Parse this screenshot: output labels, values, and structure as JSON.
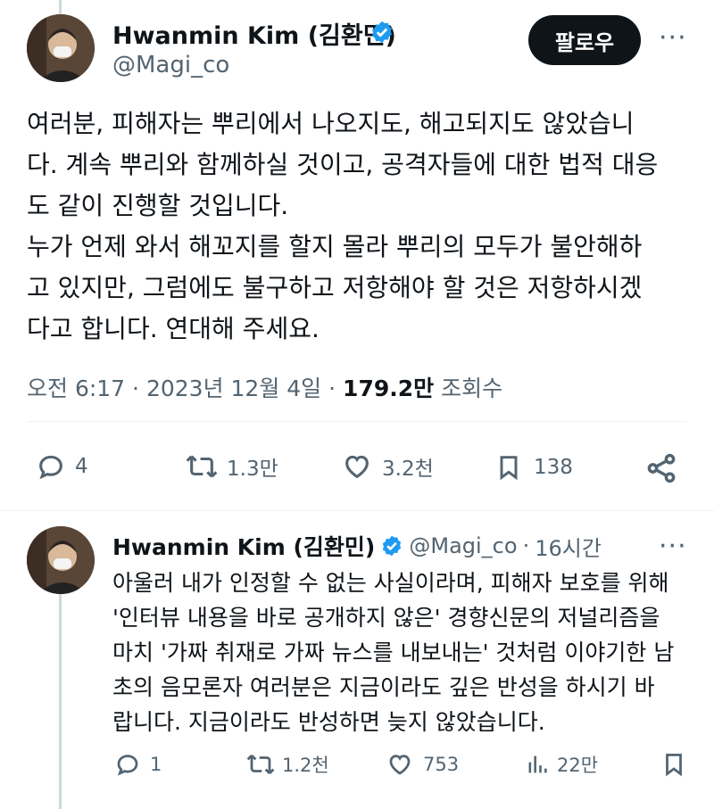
{
  "main_tweet": {
    "author_name": "Hwanmin Kim (김환민)",
    "handle": "@Magi_co",
    "follow_label": "팔로우",
    "more_label": "···",
    "lines": [
      "여러분, 피해자는 뿌리에서 나오지도, 해고되지도 않았습니",
      "다. 계속 뿌리와 함께하실 것이고, 공격자들에 대한 법적 대응",
      "도 같이 진행할 것입니다.",
      "누가 언제 와서 해꼬지를 할지 몰라 뿌리의 모두가 불안해하",
      "고 있지만, 그럼에도 불구하고 저항해야 할 것은 저항하시겠",
      "다고 합니다. 연대해 주세요."
    ],
    "time": "오전 6:17",
    "date": "2023년 12월 4일",
    "views_count": "179.2만",
    "views_label": "조회수",
    "actions": {
      "replies": "4",
      "retweets": "1.3만",
      "likes": "3.2천",
      "bookmarks": "138"
    }
  },
  "reply_tweet": {
    "author_name": "Hwanmin Kim (김환민)",
    "handle": "@Magi_co",
    "time_ago": "16시간",
    "more_label": "···",
    "lines": [
      "아울러 내가 인정할 수 없는 사실이라며, 피해자 보호를 위해",
      "'인터뷰 내용을 바로 공개하지 않은' 경향신문의 저널리즘을",
      "마치 '가짜 취재로 가짜 뉴스를 내보내는' 것처럼 이야기한 남",
      "초의 음모론자 여러분은 지금이라도 깊은 반성을 하시기 바",
      "랍니다. 지금이라도 반성하면 늦지 않았습니다."
    ],
    "actions": {
      "replies": "1",
      "retweets": "1.2천",
      "likes": "753",
      "views": "22만"
    }
  },
  "colors": {
    "verified": "#1d9bf0",
    "secondary_text": "#536471",
    "follow_button_bg": "#0f1419"
  }
}
